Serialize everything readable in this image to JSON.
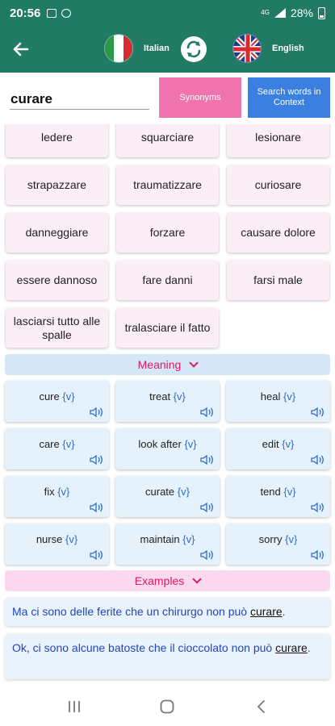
{
  "status_bar": {
    "time": "20:56",
    "network": "4G",
    "battery": "28%"
  },
  "app_bar": {
    "source_language": "Italian",
    "target_language": "English"
  },
  "search": {
    "word": "curare",
    "synonyms_label": "Synonyms",
    "context_label": "Search words in Context"
  },
  "synonyms": [
    "ledere",
    "squarciare",
    "lesionare",
    "strapazzare",
    "traumatizzare",
    "curiosare",
    "danneggiare",
    "forzare",
    "causare dolore",
    "essere dannoso",
    "fare danni",
    "farsi male",
    "lasciarsi tutto alle spalle",
    "tralasciare il fatto"
  ],
  "meaning": {
    "title": "Meaning",
    "items": [
      {
        "word": "cure",
        "pos": "{v}"
      },
      {
        "word": "treat",
        "pos": "{v}"
      },
      {
        "word": "heal",
        "pos": "{v}"
      },
      {
        "word": "care",
        "pos": "{v}"
      },
      {
        "word": "look after",
        "pos": "{v}"
      },
      {
        "word": "edit",
        "pos": "{v}"
      },
      {
        "word": "fix",
        "pos": "{v}"
      },
      {
        "word": "curate",
        "pos": "{v}"
      },
      {
        "word": "tend",
        "pos": "{v}"
      },
      {
        "word": "nurse",
        "pos": "{v}"
      },
      {
        "word": "maintain",
        "pos": "{v}"
      },
      {
        "word": "sorry",
        "pos": "{v}"
      }
    ]
  },
  "examples": {
    "title": "Examples",
    "items": [
      {
        "before": "Ma ci sono delle ferite che un chirurgo non può ",
        "highlight": "curare",
        "after": "."
      },
      {
        "before": "Ok, ci sono alcune batoste che il cioccolato non può ",
        "highlight": "curare",
        "after": "."
      }
    ]
  },
  "colors": {
    "app_bar": "#217a63",
    "synonyms_button": "#ef73ad",
    "context_button": "#3b7fe0",
    "accent": "#e0185c"
  }
}
